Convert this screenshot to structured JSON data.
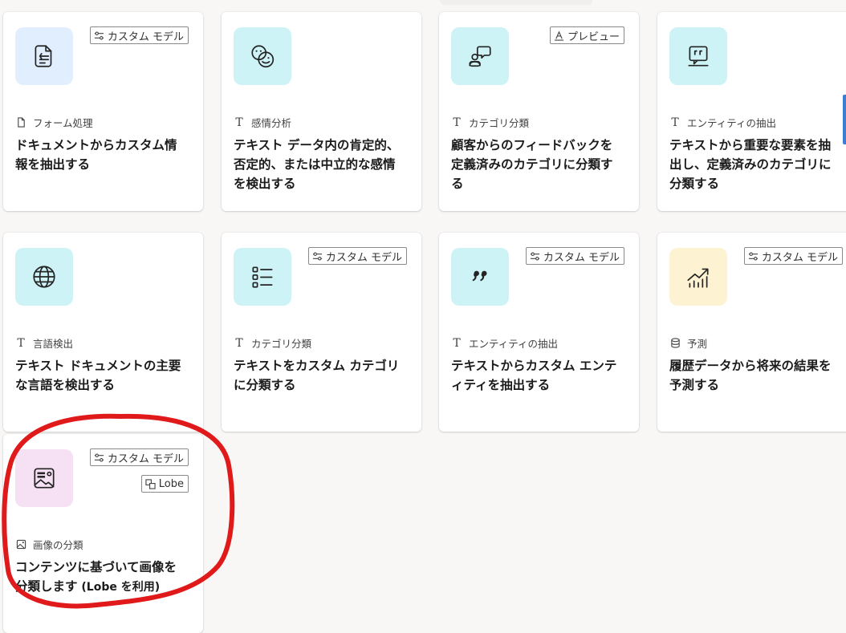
{
  "cards": [
    {
      "id": "form-processing",
      "icon": "document-extract-icon",
      "tile_color": "#e1eefd",
      "badges": [
        {
          "label": "カスタム モデル",
          "icon": "sliders-icon"
        }
      ],
      "category": "フォーム処理",
      "category_icon": "document-icon",
      "title": "ドキュメントからカスタム情報を抽出する"
    },
    {
      "id": "sentiment",
      "icon": "emoji-faces-icon",
      "tile_color": "#cdf3f6",
      "badges": [],
      "category": "感情分析",
      "category_icon": "text-T-icon",
      "title": "テキスト データ内の肯定的、否定的、または中立的な感情を検出する"
    },
    {
      "id": "feedback-classify",
      "icon": "person-feedback-icon",
      "tile_color": "#cdf3f6",
      "badges": [
        {
          "label": "プレビュー",
          "icon": "preview-icon"
        }
      ],
      "category": "カテゴリ分類",
      "category_icon": "text-T-icon",
      "title": "顧客からのフィードバックを定義済みのカテゴリに分類する"
    },
    {
      "id": "entity-extract-prebuilt",
      "icon": "chat-quote-icon",
      "tile_color": "#cdf3f6",
      "badges": [],
      "category": "エンティティの抽出",
      "category_icon": "text-T-icon",
      "title": "テキストから重要な要素を抽出し、定義済みのカテゴリに分類する"
    },
    {
      "id": "language-detect",
      "icon": "globe-icon",
      "tile_color": "#cdf3f6",
      "badges": [],
      "category": "言語検出",
      "category_icon": "text-T-icon",
      "title": "テキスト ドキュメントの主要な言語を検出する"
    },
    {
      "id": "custom-classify",
      "icon": "list-icon",
      "tile_color": "#cdf3f6",
      "badges": [
        {
          "label": "カスタム モデル",
          "icon": "sliders-icon"
        }
      ],
      "category": "カテゴリ分類",
      "category_icon": "text-T-icon",
      "title": "テキストをカスタム カテゴリに分類する"
    },
    {
      "id": "custom-entity",
      "icon": "quote-icon",
      "tile_color": "#cdf3f6",
      "badges": [
        {
          "label": "カスタム モデル",
          "icon": "sliders-icon"
        }
      ],
      "category": "エンティティの抽出",
      "category_icon": "text-T-icon",
      "title": "テキストからカスタム エンティティを抽出する"
    },
    {
      "id": "prediction",
      "icon": "chart-trend-icon",
      "tile_color": "#fdf3d2",
      "badges": [
        {
          "label": "カスタム モデル",
          "icon": "sliders-icon"
        }
      ],
      "category": "予測",
      "category_icon": "database-icon",
      "title": "履歴データから将来の結果を予測する"
    },
    {
      "id": "image-classify",
      "icon": "image-text-icon",
      "tile_color": "#f6e0f3",
      "badges": [
        {
          "label": "カスタム モデル",
          "icon": "sliders-icon"
        },
        {
          "label": "Lobe",
          "icon": "lobe-icon"
        }
      ],
      "category": "画像の分類",
      "category_icon": "image-icon",
      "title": "コンテンツに基づいて画像を分類します",
      "title_suffix": "(Lobe を利用)"
    }
  ],
  "colors": {
    "annotation": "#e0191b",
    "scroll_accent": "#3a7fd5",
    "background": "#f8f7f6"
  }
}
